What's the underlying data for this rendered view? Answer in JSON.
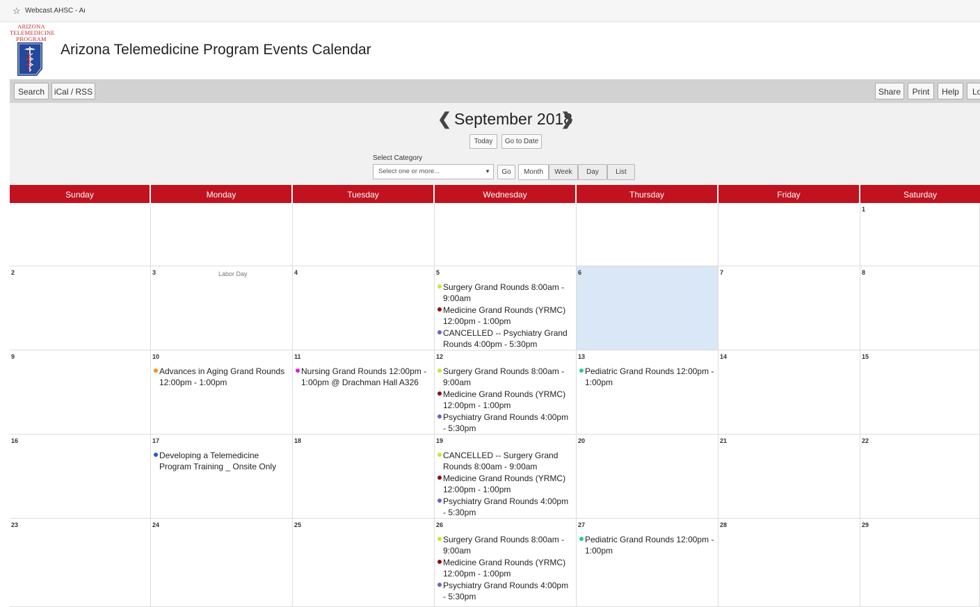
{
  "bookmark": {
    "text": "Webcast.AHSC - Arizo"
  },
  "logo": {
    "line1": "ARIZONA",
    "line2": "TELEMEDICINE",
    "line3": "PROGRAM"
  },
  "title": "Arizona Telemedicine Program Events Calendar",
  "toolbar": {
    "left": [
      "Search",
      "iCal / RSS"
    ],
    "right": [
      "Share",
      "Print",
      "Help",
      "Lo"
    ]
  },
  "nav": {
    "month": "September 2018",
    "today": "Today",
    "goto": "Go to Date",
    "category_label": "Select Category",
    "category_placeholder": "Select one or more...",
    "go": "Go",
    "views": [
      "Month",
      "Week",
      "Day",
      "List"
    ]
  },
  "colors": {
    "header_red": "#c1121f",
    "surgery": "#c6e832",
    "medicine": "#8b1010",
    "psychiatry": "#6a64c4",
    "aging": "#f2911c",
    "nursing": "#e81ad8",
    "pediatric": "#2cc79a",
    "telemedicine": "#2458d4",
    "today_bg": "#d9e7f6"
  },
  "weekdays": [
    "Sunday",
    "Monday",
    "Tuesday",
    "Wednesday",
    "Thursday",
    "Friday",
    "Saturday"
  ],
  "weeks": [
    [
      {
        "day": "",
        "events": []
      },
      {
        "day": "",
        "events": []
      },
      {
        "day": "",
        "events": []
      },
      {
        "day": "",
        "events": []
      },
      {
        "day": "",
        "events": []
      },
      {
        "day": "",
        "events": []
      },
      {
        "day": "1",
        "events": []
      }
    ],
    [
      {
        "day": "2",
        "events": []
      },
      {
        "day": "3",
        "holiday": "Labor Day",
        "events": []
      },
      {
        "day": "4",
        "events": []
      },
      {
        "day": "5",
        "events": [
          {
            "text": "Surgery Grand Rounds 8:00am - 9:00am",
            "color": "surgery"
          },
          {
            "text": "Medicine Grand Rounds (YRMC) 12:00pm - 1:00pm",
            "color": "medicine"
          },
          {
            "text": "CANCELLED -- Psychiatry Grand Rounds 4:00pm - 5:30pm",
            "color": "psychiatry"
          }
        ]
      },
      {
        "day": "6",
        "today": true,
        "events": []
      },
      {
        "day": "7",
        "events": []
      },
      {
        "day": "8",
        "events": []
      }
    ],
    [
      {
        "day": "9",
        "events": []
      },
      {
        "day": "10",
        "events": [
          {
            "text": "Advances in Aging Grand Rounds 12:00pm - 1:00pm",
            "color": "aging"
          }
        ]
      },
      {
        "day": "11",
        "events": [
          {
            "text": "Nursing Grand Rounds 12:00pm - 1:00pm @ Drachman Hall A326",
            "color": "nursing"
          }
        ]
      },
      {
        "day": "12",
        "events": [
          {
            "text": "Surgery Grand Rounds 8:00am - 9:00am",
            "color": "surgery"
          },
          {
            "text": "Medicine Grand Rounds (YRMC) 12:00pm - 1:00pm",
            "color": "medicine"
          },
          {
            "text": "Psychiatry Grand Rounds 4:00pm - 5:30pm",
            "color": "psychiatry"
          }
        ]
      },
      {
        "day": "13",
        "events": [
          {
            "text": "Pediatric Grand Rounds 12:00pm - 1:00pm",
            "color": "pediatric"
          }
        ]
      },
      {
        "day": "14",
        "events": []
      },
      {
        "day": "15",
        "events": []
      }
    ],
    [
      {
        "day": "16",
        "events": []
      },
      {
        "day": "17",
        "events": [
          {
            "text": "Developing a Telemedicine Program Training _ Onsite Only",
            "color": "telemedicine"
          }
        ]
      },
      {
        "day": "18",
        "events": []
      },
      {
        "day": "19",
        "events": [
          {
            "text": "CANCELLED -- Surgery Grand Rounds 8:00am - 9:00am",
            "color": "surgery"
          },
          {
            "text": "Medicine Grand Rounds (YRMC) 12:00pm - 1:00pm",
            "color": "medicine"
          },
          {
            "text": "Psychiatry Grand Rounds 4:00pm - 5:30pm",
            "color": "psychiatry"
          }
        ]
      },
      {
        "day": "20",
        "events": []
      },
      {
        "day": "21",
        "events": []
      },
      {
        "day": "22",
        "events": []
      }
    ],
    [
      {
        "day": "23",
        "events": []
      },
      {
        "day": "24",
        "events": []
      },
      {
        "day": "25",
        "events": []
      },
      {
        "day": "26",
        "events": [
          {
            "text": "Surgery Grand Rounds 8:00am - 9:00am",
            "color": "surgery"
          },
          {
            "text": "Medicine Grand Rounds (YRMC) 12:00pm - 1:00pm",
            "color": "medicine"
          },
          {
            "text": "Psychiatry Grand Rounds 4:00pm - 5:30pm",
            "color": "psychiatry"
          }
        ]
      },
      {
        "day": "27",
        "events": [
          {
            "text": "Pediatric Grand Rounds 12:00pm - 1:00pm",
            "color": "pediatric"
          }
        ]
      },
      {
        "day": "28",
        "events": []
      },
      {
        "day": "29",
        "events": []
      }
    ]
  ]
}
